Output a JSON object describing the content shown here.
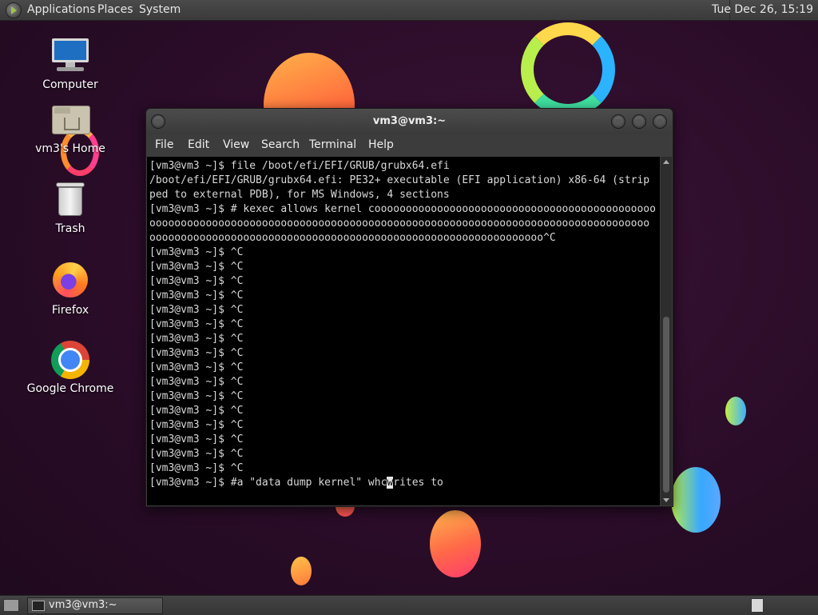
{
  "top_panel": {
    "menus": [
      "Applications",
      "Places",
      "System"
    ],
    "clock": "Tue Dec 26, 15:19"
  },
  "desktop_icons": [
    {
      "label": "Computer",
      "icon": "computer-icon"
    },
    {
      "label": "vm3's Home",
      "icon": "home-folder-icon"
    },
    {
      "label": "Trash",
      "icon": "trash-icon"
    },
    {
      "label": "Firefox",
      "icon": "firefox-icon"
    },
    {
      "label": "Google Chrome",
      "icon": "chrome-icon"
    }
  ],
  "terminal": {
    "title": "vm3@vm3:~",
    "menu": [
      "File",
      "Edit",
      "View",
      "Search",
      "Terminal",
      "Help"
    ],
    "lines": [
      "[vm3@vm3 ~]$ file /boot/efi/EFI/GRUB/grubx64.efi",
      "/boot/efi/EFI/GRUB/grubx64.efi: PE32+ executable (EFI application) x86-64 (strip",
      "ped to external PDB), for MS Windows, 4 sections",
      "[vm3@vm3 ~]$ # kexec allows kernel cooooooooooooooooooooooooooooooooooooooooooooo",
      "oooooooooooooooooooooooooooooooooooooooooooooooooooooooooooooooooooooooooooooooo",
      "ooooooooooooooooooooooooooooooooooooooooooooooooooooooooooooooo^C",
      "[vm3@vm3 ~]$ ^C",
      "[vm3@vm3 ~]$ ^C",
      "[vm3@vm3 ~]$ ^C",
      "[vm3@vm3 ~]$ ^C",
      "[vm3@vm3 ~]$ ^C",
      "[vm3@vm3 ~]$ ^C",
      "[vm3@vm3 ~]$ ^C",
      "[vm3@vm3 ~]$ ^C",
      "[vm3@vm3 ~]$ ^C",
      "[vm3@vm3 ~]$ ^C",
      "[vm3@vm3 ~]$ ^C",
      "[vm3@vm3 ~]$ ^C",
      "[vm3@vm3 ~]$ ^C",
      "[vm3@vm3 ~]$ ^C",
      "[vm3@vm3 ~]$ ^C",
      "[vm3@vm3 ~]$ ^C"
    ],
    "prompt_before_cursor": "[vm3@vm3 ~]$ #a \"data dump kernel\" whc",
    "cursor_char": "w",
    "prompt_after_cursor": "rites to"
  },
  "taskbar": {
    "window_label": "vm3@vm3:~"
  }
}
